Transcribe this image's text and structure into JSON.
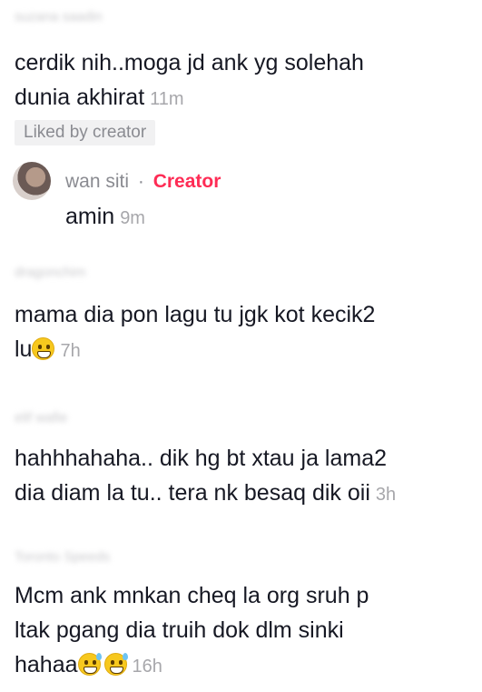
{
  "comments": [
    {
      "username": "suzana saadin",
      "line1": "cerdik nih..moga jd ank yg solehah",
      "line2": "dunia akhirat",
      "time": "11m",
      "liked_badge": "Liked by creator"
    },
    {
      "username": "dragonchim",
      "line1": "mama dia pon lagu tu jgk kot kecik2",
      "line2": "lu",
      "time": "7h"
    },
    {
      "username": "elif wafie",
      "line1": "hahhhahaha.. dik hg bt xtau ja lama2",
      "line2": "dia diam la tu.. tera nk besaq dik oii",
      "time": "3h"
    },
    {
      "username": "Toronto Speeds",
      "line1": "Mcm ank mnkan cheq la org sruh p",
      "line2": "ltak pgang dia truih dok dlm sinki",
      "line3": "hahaa",
      "time": "16h"
    }
  ],
  "reply": {
    "username": "wan siti",
    "separator": "·",
    "badge": "Creator",
    "text": "amin",
    "time": "9m"
  },
  "icons": {
    "grin": "grinning-face-emoji",
    "sweat": "grinning-face-with-sweat-emoji"
  },
  "colors": {
    "creator_badge": "#fe2c55",
    "text": "#161823",
    "muted": "#8a8b91"
  }
}
